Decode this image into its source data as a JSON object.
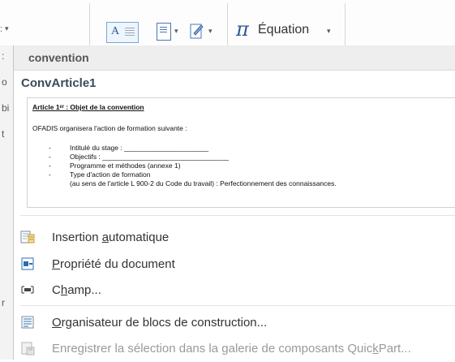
{
  "ribbon": {
    "left_fragment": ":",
    "equation_label": "Équation",
    "pi_symbol": "π"
  },
  "left_strip_chars": [
    ":",
    "o",
    "bi",
    "t",
    "r"
  ],
  "gallery": {
    "group_header": "convention",
    "entry_title": "ConvArticle1",
    "preview": {
      "title": "Article 1ᵉʳ : Objet de la convention",
      "line1": "OFADIS organisera l'action de formation suivante :",
      "items": [
        {
          "bullet": "-",
          "text": "Intitulé du stage : ______________________"
        },
        {
          "bullet": "-",
          "text": "Objectifs : _________________________________"
        },
        {
          "bullet": "-",
          "text": "Programme et méthodes (annexe 1)"
        },
        {
          "bullet": "-",
          "text": "Type d'action de formation"
        }
      ],
      "last_line": "(au sens de l'article L 900-2 du Code du travail)  : Perfectionnement des connaissances."
    }
  },
  "menu_items": [
    {
      "pre": "Insertion ",
      "key": "a",
      "post": "utomatique",
      "icon": "autotext-icon",
      "disabled": false
    },
    {
      "pre": "",
      "key": "P",
      "post": "ropriété du document",
      "icon": "document-property-icon",
      "disabled": false
    },
    {
      "pre": "C",
      "key": "h",
      "post": "amp...",
      "icon": "field-icon",
      "disabled": false
    },
    {
      "pre": "",
      "key": "O",
      "post": "rganisateur de blocs de construction...",
      "icon": "building-blocks-organizer-icon",
      "disabled": false
    },
    {
      "pre": "Enregistrer la sélection dans la galerie de composants Quic",
      "key": "k",
      "post": "Part...",
      "icon": "save-selection-icon",
      "disabled": true
    }
  ]
}
